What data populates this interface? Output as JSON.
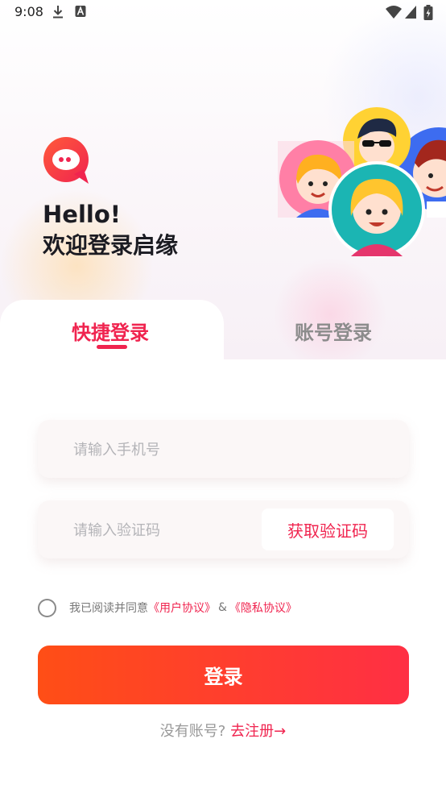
{
  "status_bar": {
    "time": "9:08",
    "icons": [
      "download-icon",
      "a-badge-icon",
      "wifi-icon",
      "signal-icon",
      "battery-icon"
    ]
  },
  "greeting": {
    "hello": "Hello!",
    "welcome": "欢迎登录启缘"
  },
  "tabs": [
    {
      "label": "快捷登录",
      "active": true
    },
    {
      "label": "账号登录",
      "active": false
    }
  ],
  "form": {
    "phone_placeholder": "请输入手机号",
    "code_placeholder": "请输入验证码",
    "get_code_label": "获取验证码"
  },
  "agreement": {
    "prefix": "我已阅读并同意",
    "user_agreement": "《用户协议》",
    "connector": "&",
    "privacy_agreement": "《隐私协议》",
    "checked": false
  },
  "login_label": "登录",
  "register": {
    "prompt": "没有账号?",
    "link": "去注册→"
  },
  "colors": {
    "accent": "#f0244f",
    "button_start": "#ff4e16",
    "button_end": "#ff2f44"
  }
}
